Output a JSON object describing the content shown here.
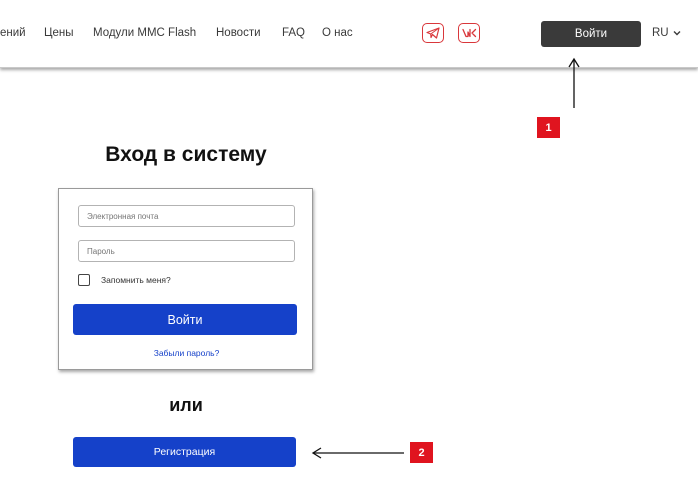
{
  "header": {
    "nav": [
      "ений",
      "Цены",
      "Модули MMC Flash",
      "Новости",
      "FAQ",
      "О нас"
    ],
    "social": [
      "telegram-icon",
      "vk-icon"
    ],
    "login_label": "Войти",
    "lang": "RU"
  },
  "annotations": {
    "marker1": "1",
    "marker2": "2"
  },
  "login": {
    "title": "Вход в систему",
    "email_placeholder": "Электронная почта",
    "password_placeholder": "Пароль",
    "remember_label": "Запомнить меня?",
    "submit_label": "Войти",
    "forgot_label": "Забыли пароль?"
  },
  "or_label": "или",
  "register_label": "Регистрация",
  "colors": {
    "primary": "#1541c9",
    "dark_button": "#3a3a3a",
    "marker": "#e0141f",
    "social": "#d9373b"
  }
}
